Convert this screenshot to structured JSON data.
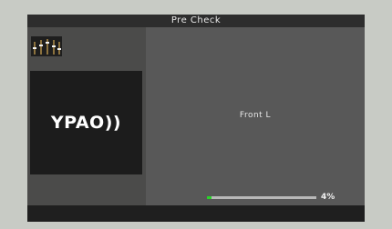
{
  "header": {
    "title": "Pre Check"
  },
  "logo": {
    "text": "YPAO))"
  },
  "measurement": {
    "channel": "Front L",
    "progress_label": "4%",
    "progress_value": 0.04
  },
  "icons": {
    "speaker_level": "speaker-level-icon"
  },
  "colors": {
    "progress_fill": "#29d329",
    "background": "#555556",
    "title_bar": "#2d2d2d"
  }
}
